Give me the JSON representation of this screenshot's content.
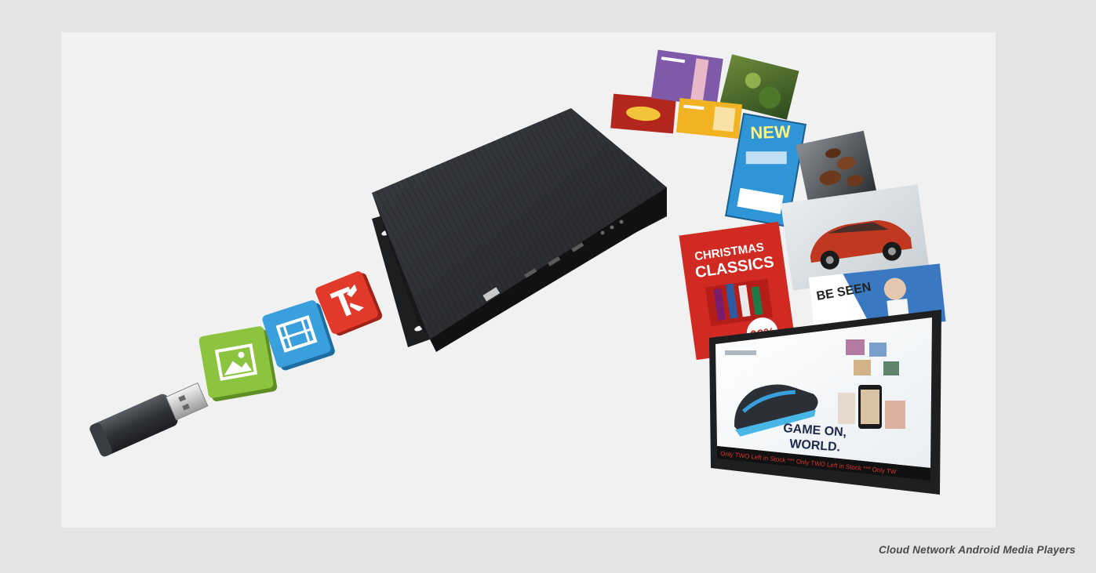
{
  "caption": "Cloud Network Android Media Players",
  "artwork": {
    "texts": {
      "new_label": "NEW",
      "christmas_label": "CHRISTMAS",
      "classics_label": "CLASSICS",
      "percent_label": "60%",
      "been_label": "BE SEEN",
      "game_on_label": "GAME ON,",
      "world_label": "WORLD.",
      "ticker_text": "Only TWO Left in Stock *** Only TWO Left in Stock *** Only TW"
    }
  },
  "colors": {
    "page_background": "#e4e4e4",
    "panel_background": "#f1f1f1",
    "media_box": "#2a2c2f",
    "icon_green": "#8cc43f",
    "icon_blue": "#3aa0dd",
    "icon_red": "#e23a2a",
    "screen_frame": "#1e1f21"
  },
  "icons": [
    "usb-drive-icon",
    "image-icon",
    "video-icon",
    "text-icon",
    "media-player-box-icon",
    "display-screen-icon"
  ]
}
